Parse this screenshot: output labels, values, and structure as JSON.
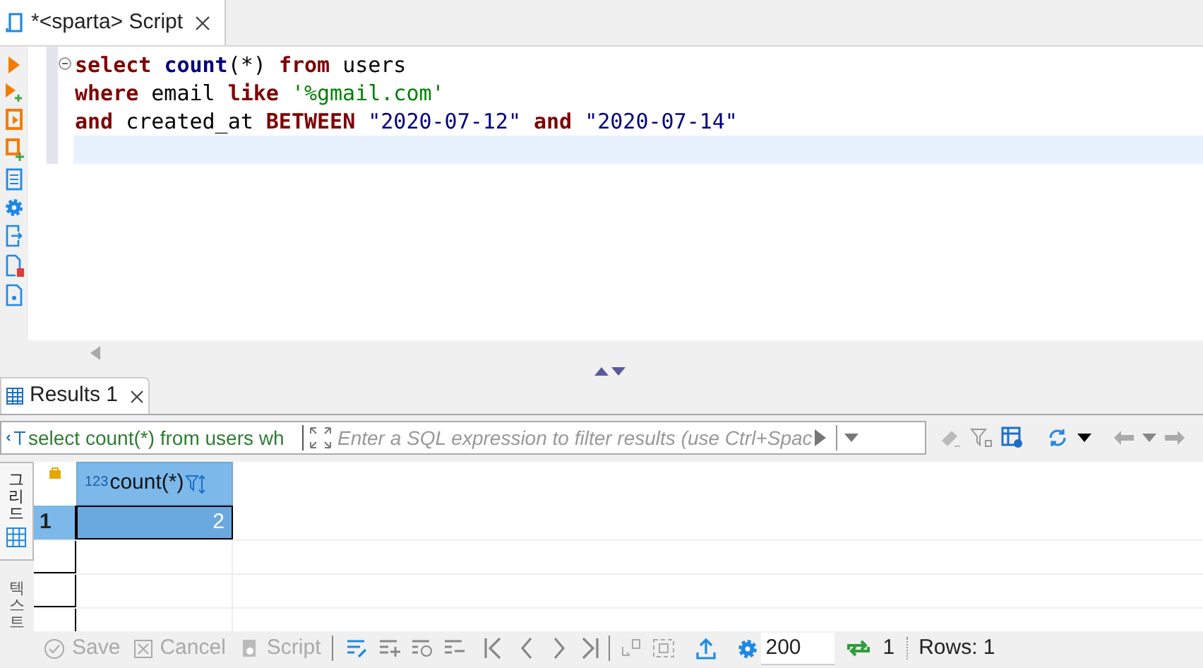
{
  "editor_tab": {
    "title": "*<sparta> Script",
    "selected": true
  },
  "code_lines": [
    {
      "current": false,
      "tokens": [
        {
          "kind": "keyword",
          "text": "select",
          "space_before": false
        },
        {
          "kind": "function",
          "text": "count",
          "space_before": true
        },
        {
          "kind": "plain",
          "text": "(*)",
          "space_before": false
        },
        {
          "kind": "keyword",
          "text": "from",
          "space_before": true
        },
        {
          "kind": "plain",
          "text": "users",
          "space_before": true
        }
      ]
    },
    {
      "current": false,
      "tokens": [
        {
          "kind": "keyword",
          "text": "where",
          "space_before": false
        },
        {
          "kind": "plain",
          "text": "email",
          "space_before": true
        },
        {
          "kind": "keyword",
          "text": "like",
          "space_before": true
        },
        {
          "kind": "string",
          "text": "'%gmail.com'",
          "space_before": true
        }
      ]
    },
    {
      "current": false,
      "tokens": [
        {
          "kind": "keyword",
          "text": "and",
          "space_before": false
        },
        {
          "kind": "plain",
          "text": "created_at",
          "space_before": true
        },
        {
          "kind": "keyword",
          "text": "BETWEEN",
          "space_before": true
        },
        {
          "kind": "quoted",
          "text": "\"2020-07-12\"",
          "space_before": true
        },
        {
          "kind": "keyword",
          "text": "and",
          "space_before": true
        },
        {
          "kind": "quoted",
          "text": "\"2020-07-14\"",
          "space_before": true
        }
      ]
    },
    {
      "current": true
    }
  ],
  "results_tab": {
    "label": "Results 1",
    "selected": true
  },
  "filter": {
    "query": "select count(*) from users wh",
    "placeholder": "Enter a SQL expression to filter results (use Ctrl+Spac"
  },
  "side_tabs": [
    {
      "label": "그리드",
      "selected": true
    },
    {
      "label": "텍스트",
      "selected": false
    }
  ],
  "grid": {
    "columns": [
      {
        "type_label": "123",
        "name": "count(*)"
      }
    ],
    "rows": [
      {
        "number": "1",
        "cells": [
          "2"
        ],
        "selected": true
      }
    ]
  },
  "bottom_toolbar": {
    "actions": [
      {
        "label": "Save",
        "disabled": true
      },
      {
        "label": "Cancel",
        "disabled": true
      },
      {
        "label": "Script",
        "disabled": true
      }
    ],
    "fetch_size": "200",
    "refresh_count": "1",
    "status": "Rows: 1"
  }
}
